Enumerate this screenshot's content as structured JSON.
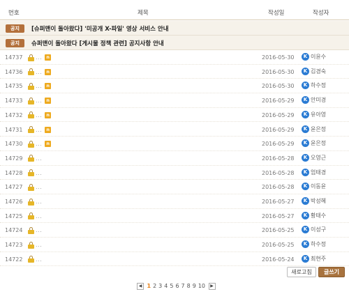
{
  "header": {
    "num": "번호",
    "title": "제목",
    "date": "작성일",
    "author": "작성자"
  },
  "notices": [
    {
      "badge": "공지",
      "title": "[슈퍼맨이 돌아왔다] '미공개 X-파일' 영상 서비스 안내"
    },
    {
      "badge": "공지",
      "title": "슈퍼맨이 돌아왔다 [게시물 정책 관련] 공지사항 안내"
    }
  ],
  "posts": [
    {
      "num": "14737",
      "dots": "...",
      "new": true,
      "new_label": "n",
      "date": "2016-05-30",
      "author": "이윤수"
    },
    {
      "num": "14736",
      "dots": "...",
      "new": true,
      "new_label": "n",
      "date": "2016-05-30",
      "author": "김경숙"
    },
    {
      "num": "14735",
      "dots": "...",
      "new": true,
      "new_label": "n",
      "date": "2016-05-30",
      "author": "하수정"
    },
    {
      "num": "14733",
      "dots": "...",
      "new": true,
      "new_label": "n",
      "date": "2016-05-29",
      "author": "안미경"
    },
    {
      "num": "14732",
      "dots": "...",
      "new": true,
      "new_label": "n",
      "date": "2016-05-29",
      "author": "유아영"
    },
    {
      "num": "14731",
      "dots": "...",
      "new": true,
      "new_label": "n",
      "date": "2016-05-29",
      "author": "윤은정"
    },
    {
      "num": "14730",
      "dots": "...",
      "new": true,
      "new_label": "n",
      "date": "2016-05-29",
      "author": "윤은정"
    },
    {
      "num": "14729",
      "dots": "...",
      "new": false,
      "new_label": "",
      "date": "2016-05-28",
      "author": "오영근"
    },
    {
      "num": "14728",
      "dots": "...",
      "new": false,
      "new_label": "",
      "date": "2016-05-28",
      "author": "엄태경"
    },
    {
      "num": "14727",
      "dots": "...",
      "new": false,
      "new_label": "",
      "date": "2016-05-28",
      "author": "이동윤"
    },
    {
      "num": "14726",
      "dots": "...",
      "new": false,
      "new_label": "",
      "date": "2016-05-27",
      "author": "박성혜"
    },
    {
      "num": "14725",
      "dots": "...",
      "new": false,
      "new_label": "",
      "date": "2016-05-27",
      "author": "황태수"
    },
    {
      "num": "14724",
      "dots": "...",
      "new": false,
      "new_label": "",
      "date": "2016-05-25",
      "author": "이성구"
    },
    {
      "num": "14723",
      "dots": "...",
      "new": false,
      "new_label": "",
      "date": "2016-05-25",
      "author": "하수정"
    },
    {
      "num": "14722",
      "dots": "...",
      "new": false,
      "new_label": "",
      "date": "2016-05-24",
      "author": "최현주"
    }
  ],
  "author_badge": "K",
  "buttons": {
    "refresh": "새로고침",
    "write": "글쓰기"
  },
  "pager": {
    "prev": "◀",
    "next": "▶",
    "pages": [
      "1",
      "2",
      "3",
      "4",
      "5",
      "6",
      "7",
      "8",
      "9",
      "10"
    ],
    "current": "1"
  },
  "colors": {
    "notice_badge": "#b3703b",
    "new_badge": "#eeaa1f",
    "author_badge": "#2a7bd3",
    "write_button": "#a8733e",
    "current_page": "#e8821a"
  },
  "icons": {
    "lock": "lock-icon",
    "new": "new-badge-icon",
    "author": "k-user-icon"
  }
}
